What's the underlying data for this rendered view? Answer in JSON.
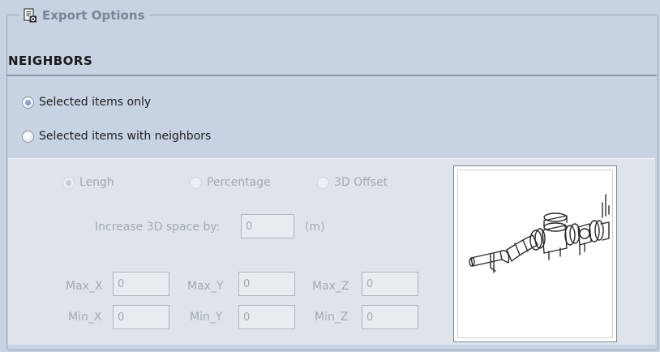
{
  "group": {
    "title": "Export Options",
    "icon": "export-options-icon"
  },
  "neighbors": {
    "title": "NEIGHBORS",
    "options": [
      {
        "label": "Selected items only",
        "checked": true
      },
      {
        "label": "Selected items with neighbors",
        "checked": false
      }
    ]
  },
  "space": {
    "modes": [
      {
        "label": "Lengh",
        "checked": true
      },
      {
        "label": "Percentage",
        "checked": false
      },
      {
        "label": "3D Offset",
        "checked": false
      }
    ],
    "increase_label": "Increase 3D space by:",
    "increase_value": "0",
    "unit": "(m)",
    "max_x_label": "Max_X",
    "max_x_value": "0",
    "max_y_label": "Max_Y",
    "max_y_value": "0",
    "max_z_label": "Max_Z",
    "max_z_value": "0",
    "min_x_label": "Min_X",
    "min_x_value": "0",
    "min_y_label": "Min_Y",
    "min_y_value": "0",
    "min_z_label": "Min_Z",
    "min_z_value": "0"
  },
  "preview": {
    "image": "pipe-assembly-preview"
  },
  "colors": {
    "background": "#c7d2e2",
    "panel": "#dfe4eb",
    "disabled_text": "#a3a9b2"
  }
}
